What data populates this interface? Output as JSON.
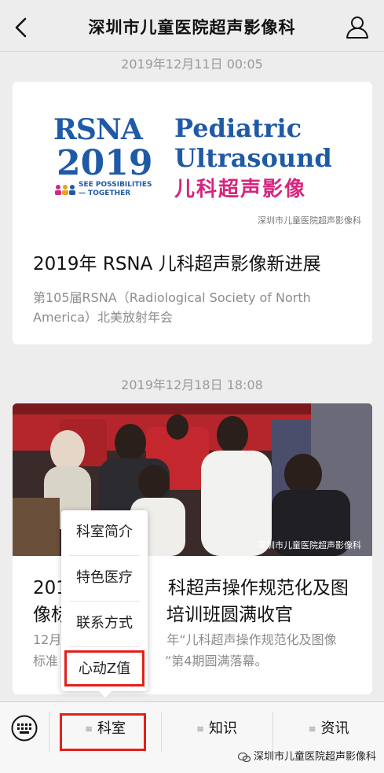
{
  "header": {
    "title": "深圳市儿童医院超声影像科",
    "back_icon": "chevron-left-icon",
    "profile_icon": "person-icon"
  },
  "feed": [
    {
      "timestamp": "2019年12月11日 00:05",
      "banner": {
        "rsna": "RSNA",
        "year": "2019",
        "pediatric": "Pediatric",
        "ultrasound": "Ultrasound",
        "chinese": "儿科超声影像",
        "tagline_1": "SEE POSSIBILITIES",
        "tagline_2": "— TOGETHER",
        "watermark": "深圳市儿童医院超声影像科"
      },
      "title": "2019年 RSNA 儿科超声影像新进展",
      "description": "第105届RSNA（Radiological Society of North America）北美放射年会"
    },
    {
      "timestamp": "2019年12月18日 18:08",
      "photo_watermark": "深圳市儿童医院超声影像科",
      "title_line1": "201",
      "title_line1_end": "科超声操作规范化及图",
      "title_line2": "像标",
      "title_line2_end": "培训班圆满收官",
      "desc_line1": "12月",
      "desc_line1_end": "年“儿科超声操作规范化及图像",
      "desc_line2": "标准",
      "desc_line2_end": "”第4期圆满落幕。"
    }
  ],
  "popup_menu": {
    "items": [
      "科室简介",
      "特色医疗",
      "联系方式",
      "心动Z值"
    ],
    "highlighted": "心动Z值"
  },
  "bottom_menu": {
    "keyboard_icon": "keyboard-icon",
    "tabs": [
      "科室",
      "知识",
      "资讯"
    ],
    "active_tab": "科室",
    "watermark": "深圳市儿童医院超声影像科"
  },
  "colors": {
    "highlight_border": "#e3201b",
    "rsna_blue": "#1f5aa6",
    "magenta": "#d6257d"
  }
}
